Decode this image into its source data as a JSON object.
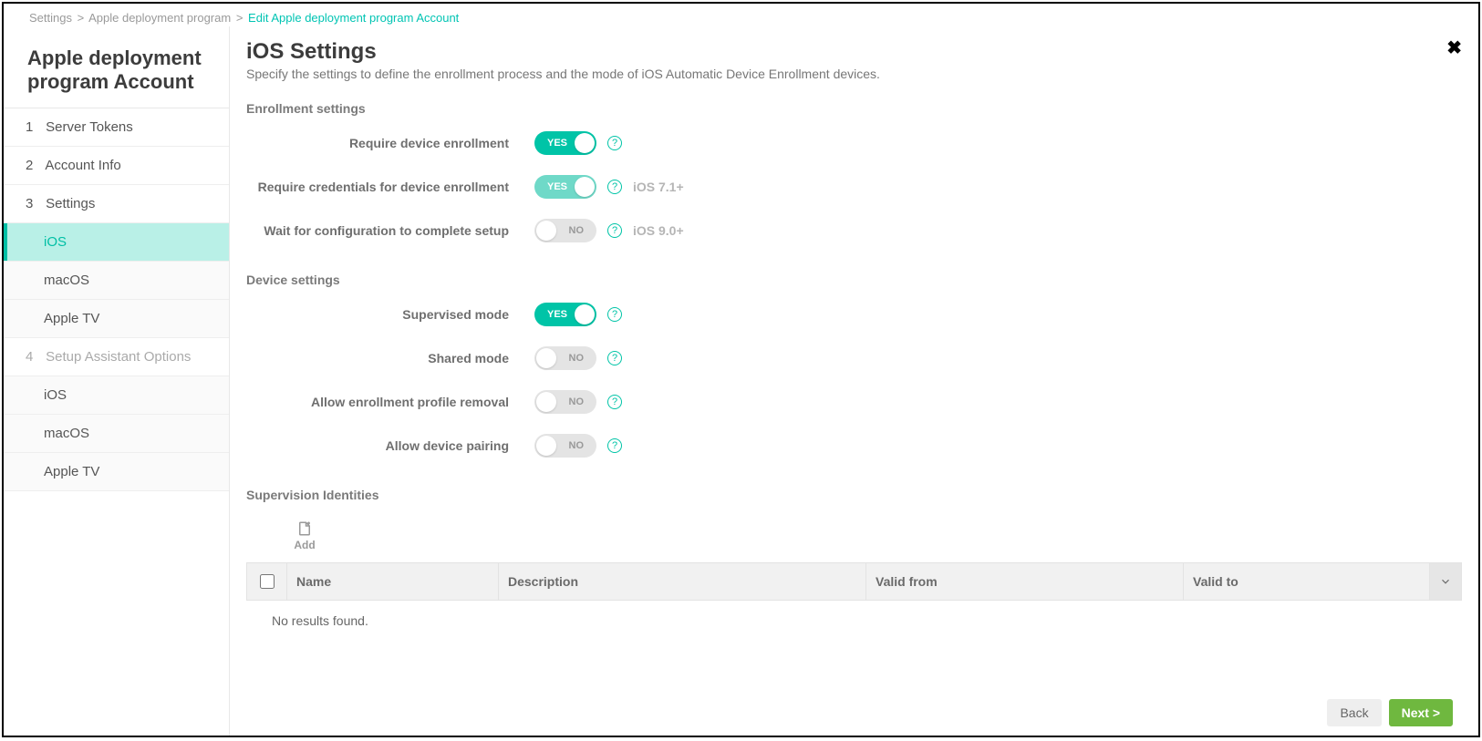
{
  "breadcrumb": {
    "a": "Settings",
    "b": "Apple deployment program",
    "c": "Edit Apple deployment program Account"
  },
  "sidebar": {
    "title": "Apple deployment program Account",
    "items": [
      {
        "num": "1",
        "label": "Server Tokens"
      },
      {
        "num": "2",
        "label": "Account Info"
      },
      {
        "num": "3",
        "label": "Settings"
      },
      {
        "num": "4",
        "label": "Setup Assistant Options"
      }
    ],
    "subs3": [
      {
        "label": "iOS"
      },
      {
        "label": "macOS"
      },
      {
        "label": "Apple TV"
      }
    ],
    "subs4": [
      {
        "label": "iOS"
      },
      {
        "label": "macOS"
      },
      {
        "label": "Apple TV"
      }
    ]
  },
  "page": {
    "title": "iOS Settings",
    "subtitle": "Specify the settings to define the enrollment process and the mode of iOS Automatic Device Enrollment devices."
  },
  "sections": {
    "enroll": "Enrollment settings",
    "device": "Device settings",
    "sup": "Supervision Identities"
  },
  "toggles": {
    "req_enroll": {
      "label": "Require device enrollment",
      "text": "YES"
    },
    "req_cred": {
      "label": "Require credentials for device enrollment",
      "text": "YES",
      "hint": "iOS 7.1+"
    },
    "wait_conf": {
      "label": "Wait for configuration to complete setup",
      "text": "NO",
      "hint": "iOS 9.0+"
    },
    "supervised": {
      "label": "Supervised mode",
      "text": "YES"
    },
    "shared": {
      "label": "Shared mode",
      "text": "NO"
    },
    "allow_remove": {
      "label": "Allow enrollment profile removal",
      "text": "NO"
    },
    "allow_pair": {
      "label": "Allow device pairing",
      "text": "NO"
    }
  },
  "add": {
    "label": "Add"
  },
  "table": {
    "cols": {
      "name": "Name",
      "desc": "Description",
      "vf": "Valid from",
      "vt": "Valid to"
    },
    "empty": "No results found."
  },
  "footer": {
    "back": "Back",
    "next": "Next >"
  },
  "help": "?"
}
